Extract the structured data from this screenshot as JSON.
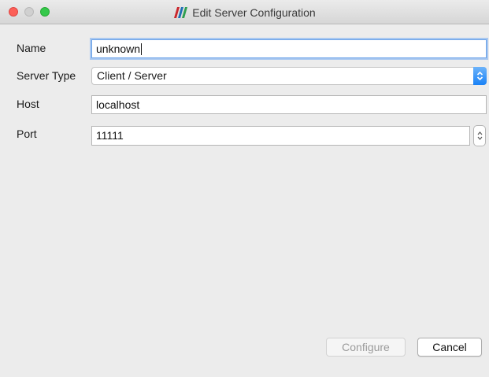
{
  "window": {
    "title": "Edit Server Configuration",
    "app_icon": "paraview-logo-icon"
  },
  "form": {
    "name": {
      "label": "Name",
      "value": "unknown"
    },
    "server_type": {
      "label": "Server Type",
      "value": "Client / Server"
    },
    "host": {
      "label": "Host",
      "value": "localhost"
    },
    "port": {
      "label": "Port",
      "value": "11111"
    }
  },
  "buttons": {
    "configure": "Configure",
    "cancel": "Cancel"
  },
  "colors": {
    "accent": "#1a82f6",
    "focus_ring": "#6aa2e8",
    "window_bg": "#ececec"
  }
}
